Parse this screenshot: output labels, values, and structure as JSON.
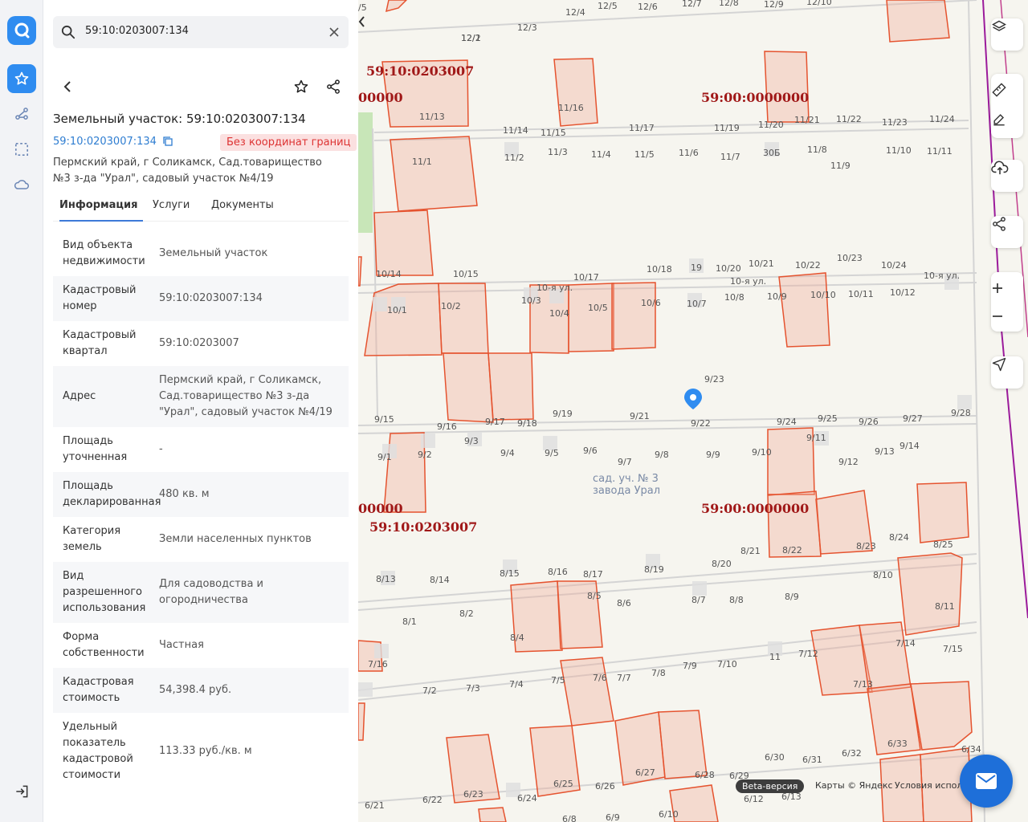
{
  "rail": {
    "items": [
      "logo-icon",
      "star-icon",
      "route-icon",
      "select-area-icon",
      "cloud-icon",
      "logout-icon"
    ]
  },
  "search": {
    "value": "59:10:0203007:134",
    "placeholder": ""
  },
  "object": {
    "title": "Земельный участок: 59:10:0203007:134",
    "cad_number": "59:10:0203007:134",
    "badge": "Без координат границ",
    "address": "Пермский край, г Соликамск, Сад.товарищество №3 з-да \"Урал\", садовый участок №4/19"
  },
  "tabs": [
    "Информация",
    "Услуги",
    "Документы"
  ],
  "info_rows": [
    {
      "k": "Вид объекта недвижимости",
      "v": "Земельный участок"
    },
    {
      "k": "Кадастровый номер",
      "v": "59:10:0203007:134"
    },
    {
      "k": "Кадастровый квартал",
      "v": "59:10:0203007"
    },
    {
      "k": "Адрес",
      "v": "Пермский край, г Соликамск, Сад.товарищество №3 з-да \"Урал\", садовый участок №4/19"
    },
    {
      "k": "Площадь уточненная",
      "v": "-"
    },
    {
      "k": "Площадь декларированная",
      "v": "480 кв. м"
    },
    {
      "k": "Категория земель",
      "v": "Земли населенных пунктов"
    },
    {
      "k": "Вид разрешенного использования",
      "v": "Для садоводства и огородничества"
    },
    {
      "k": "Форма собственности",
      "v": "Частная"
    },
    {
      "k": "Кадастровая стоимость",
      "v": "54,398.4 руб."
    },
    {
      "k": "Удельный показатель кадастровой стоимости",
      "v": "113.33 руб./кв. м"
    }
  ],
  "map": {
    "quarter_labels": [
      "59:10:0203007",
      "00000",
      "59:00:0000000",
      "00000",
      "59:00:0000000",
      "59:10:0203007"
    ],
    "street_labels": [
      "10-я ул.",
      "10-я ул.",
      "10-я ул."
    ],
    "area_label": [
      "сад. уч. № 3",
      "завода Урал"
    ],
    "plot_labels": [
      "12/1",
      "12/2",
      "12/3",
      "12/4",
      "12/5",
      "12/6",
      "12/7",
      "12/8",
      "12/9",
      "12/10",
      "11/13",
      "11/16",
      "11/14",
      "11/15",
      "11/17",
      "11/19",
      "11/20",
      "11/21",
      "11/22",
      "11/23",
      "11/24",
      "11/1",
      "11/2",
      "11/3",
      "11/4",
      "11/5",
      "11/6",
      "11/7",
      "30Б",
      "11/8",
      "11/9",
      "11/10",
      "11/11",
      "10/14",
      "10/15",
      "10/17",
      "10/18",
      "19",
      "10/20",
      "10/21",
      "10/22",
      "10/23",
      "10/24",
      "10/1",
      "10/2",
      "10/3",
      "10/4",
      "10/5",
      "10/6",
      "10/7",
      "10/8",
      "10/9",
      "10/10",
      "10/11",
      "10/12",
      "9/23",
      "9/15",
      "9/16",
      "9/17",
      "9/18",
      "9/19",
      "9/21",
      "9/22",
      "9/24",
      "9/25",
      "9/26",
      "9/27",
      "9/28",
      "9/1",
      "9/2",
      "9/3",
      "9/4",
      "9/5",
      "9/6",
      "9/7",
      "9/8",
      "9/9",
      "9/10",
      "9/11",
      "9/12",
      "9/13",
      "9/14",
      "8/24",
      "8/25",
      "8/21",
      "8/22",
      "8/23",
      "8/20",
      "8/13",
      "8/14",
      "8/15",
      "8/16",
      "8/17",
      "8/19",
      "8/10",
      "8/5",
      "8/6",
      "8/7",
      "8/8",
      "8/9",
      "8/11",
      "8/1",
      "8/2",
      "8/4",
      "7/14",
      "7/15",
      "7/16",
      "11",
      "7/12",
      "7/9",
      "7/10",
      "7/2",
      "7/3",
      "7/4",
      "7/5",
      "7/6",
      "7/7",
      "7/8",
      "7/13",
      "6/33",
      "6/34",
      "6/30",
      "6/31",
      "6/32",
      "6/29",
      "6/23",
      "6/25",
      "6/26",
      "6/27",
      "6/28",
      "6/21",
      "6/22",
      "6/24",
      "6/12",
      "6/13",
      "6/8",
      "6/9",
      "6/10",
      "/5"
    ],
    "beta": "Beta-версия",
    "copyright": "Карты © Яндекс",
    "terms": "Условия испол"
  },
  "map_controls": [
    "layers-icon",
    "ruler-icon",
    "edit-icon",
    "upload-icon",
    "share-icon",
    "zoom-in-icon",
    "zoom-out-icon",
    "locate-icon"
  ],
  "colors": {
    "accent": "#1e6fd9",
    "parcel": "#e5532f",
    "quarter": "#a01818",
    "badge_bg": "#fbe0e0"
  }
}
